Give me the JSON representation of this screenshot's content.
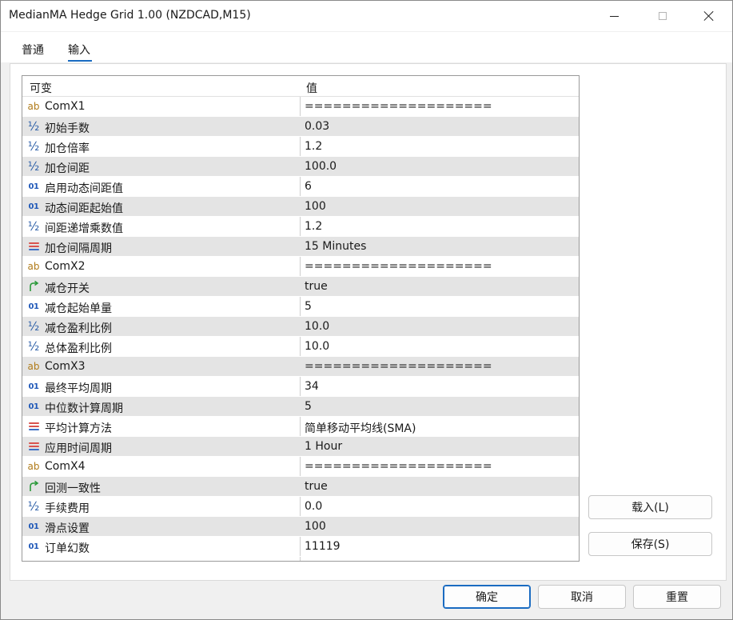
{
  "window": {
    "title": "MedianMA Hedge Grid 1.00 (NZDCAD,M15)"
  },
  "tabs": [
    "普通",
    "输入"
  ],
  "grid": {
    "header_variable": "可变",
    "header_value": "值",
    "rows": [
      {
        "icon": "string",
        "name": "ComX1",
        "value": "===================="
      },
      {
        "icon": "double",
        "name": "初始手数",
        "value": "0.03"
      },
      {
        "icon": "double",
        "name": "加仓倍率",
        "value": "1.2"
      },
      {
        "icon": "double",
        "name": "加仓间距",
        "value": "100.0"
      },
      {
        "icon": "integer",
        "name": "启用动态间距值",
        "value": "6"
      },
      {
        "icon": "integer",
        "name": "动态间距起始值",
        "value": "100"
      },
      {
        "icon": "double",
        "name": "间距递增乘数值",
        "value": "1.2"
      },
      {
        "icon": "enum",
        "name": "加仓间隔周期",
        "value": "15 Minutes"
      },
      {
        "icon": "string",
        "name": "ComX2",
        "value": "===================="
      },
      {
        "icon": "bool",
        "name": "减仓开关",
        "value": "true"
      },
      {
        "icon": "integer",
        "name": "减仓起始单量",
        "value": "5"
      },
      {
        "icon": "double",
        "name": "减仓盈利比例",
        "value": "10.0"
      },
      {
        "icon": "double",
        "name": "总体盈利比例",
        "value": "10.0"
      },
      {
        "icon": "string",
        "name": "ComX3",
        "value": "===================="
      },
      {
        "icon": "integer",
        "name": "最终平均周期",
        "value": "34"
      },
      {
        "icon": "integer",
        "name": "中位数计算周期",
        "value": "5"
      },
      {
        "icon": "enum",
        "name": "平均计算方法",
        "value": "简单移动平均线(SMA)"
      },
      {
        "icon": "enum",
        "name": "应用时间周期",
        "value": "1 Hour"
      },
      {
        "icon": "string",
        "name": "ComX4",
        "value": "===================="
      },
      {
        "icon": "bool",
        "name": "回测一致性",
        "value": "true"
      },
      {
        "icon": "double",
        "name": "手续费用",
        "value": "0.0"
      },
      {
        "icon": "integer",
        "name": "滑点设置",
        "value": "100"
      },
      {
        "icon": "integer",
        "name": "订单幻数",
        "value": "11119"
      }
    ]
  },
  "buttons": {
    "load": "载入(L)",
    "save": "保存(S)",
    "ok": "确定",
    "cancel": "取消",
    "reset": "重置"
  },
  "icon_glyphs": {
    "string": "ab",
    "double": "½",
    "integer": "01"
  },
  "colors": {
    "accent": "#1a6bc1",
    "row_alt": "#e4e4e4",
    "string_icon": "#b07a18",
    "number_icon": "#2c5fa8",
    "bool_icon": "#2a9a3a",
    "enum_icon_top": "#d9534f",
    "enum_icon_bottom": "#3f6fc4"
  }
}
